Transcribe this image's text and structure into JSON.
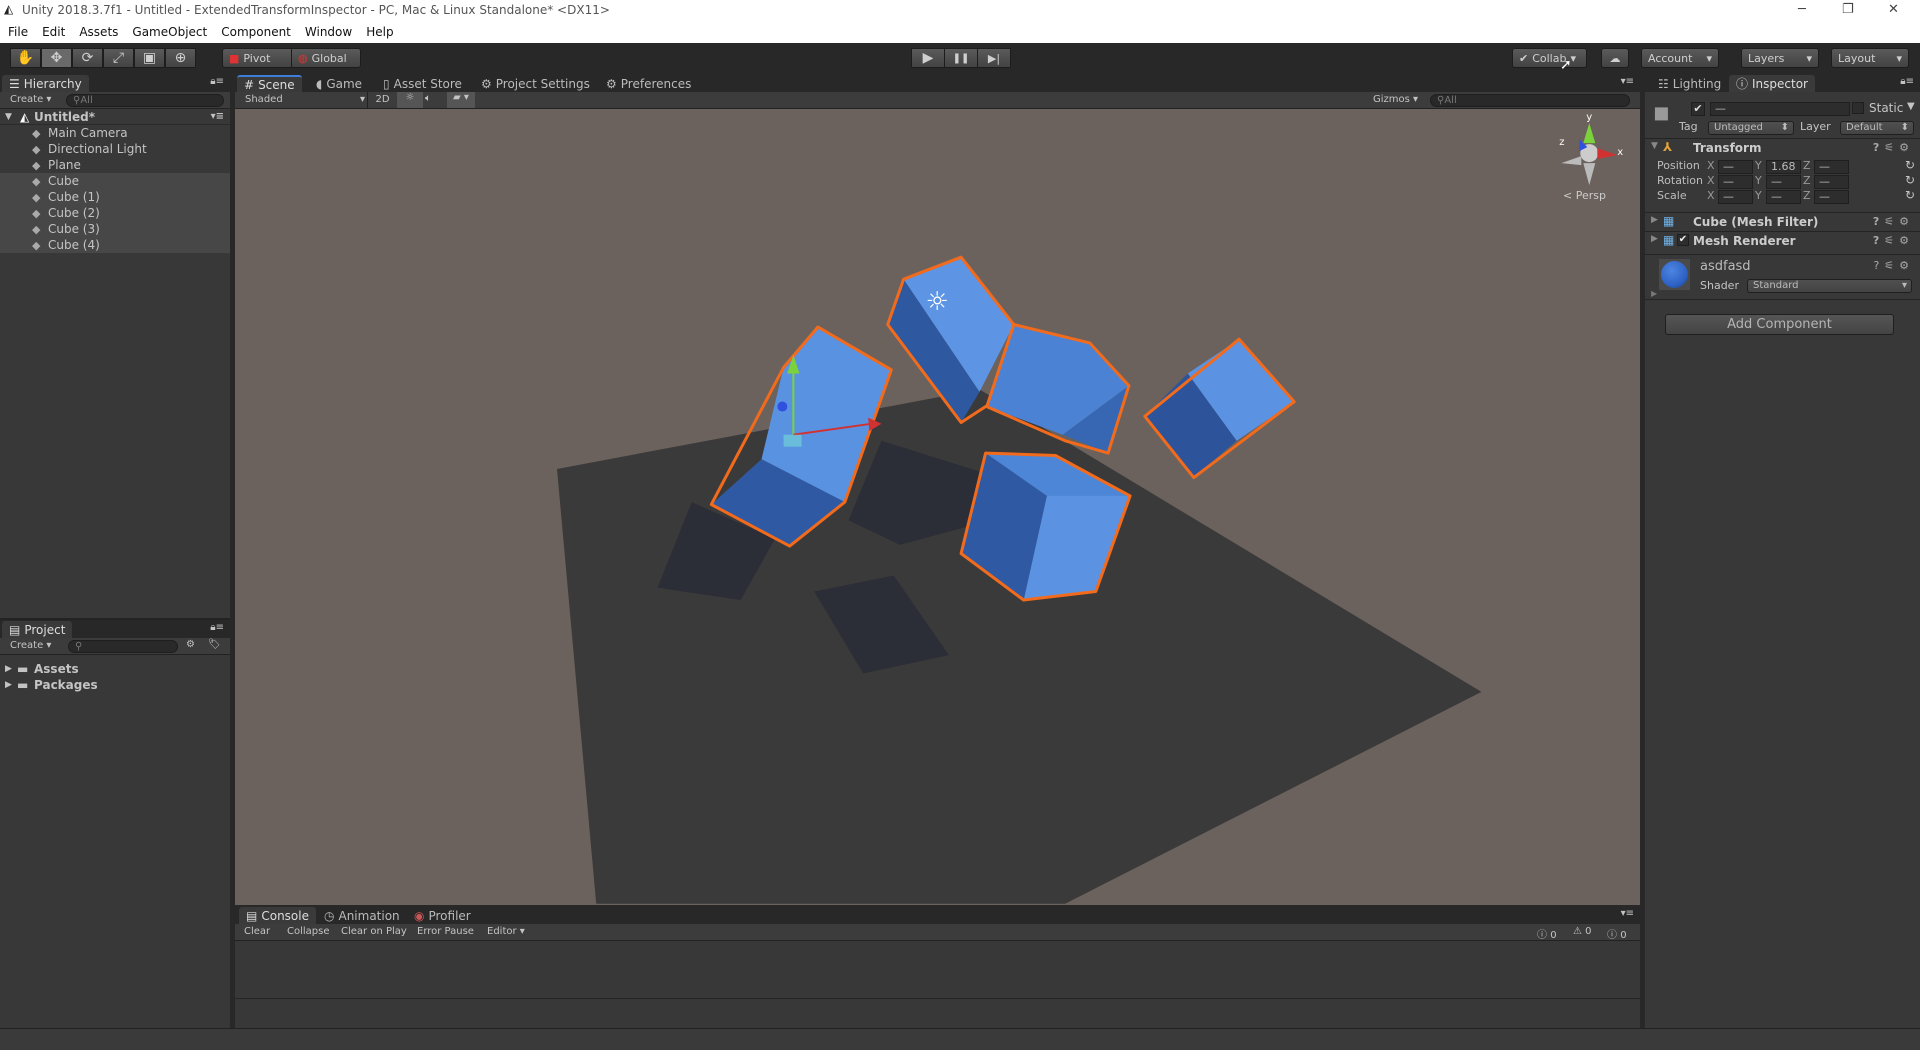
{
  "window": {
    "title": "Unity 2018.3.7f1 - Untitled - ExtendedTransformInspector - PC, Mac & Linux Standalone* <DX11>",
    "minimize": "─",
    "restore": "❐",
    "close": "✕"
  },
  "menu": [
    "File",
    "Edit",
    "Assets",
    "GameObject",
    "Component",
    "Window",
    "Help"
  ],
  "toolbar": {
    "tools": [
      "hand-tool",
      "move-tool",
      "rotate-tool",
      "scale-tool",
      "rect-tool",
      "transform-tool"
    ],
    "tool_glyphs": [
      "✋",
      "✥",
      "⟳",
      "⤢",
      "▣",
      "⊕"
    ],
    "active_tool": 1,
    "pivot": "Pivot",
    "global": "Global",
    "play": "▶",
    "pause": "❚❚",
    "step": "▶|",
    "collab": "Collab",
    "account": "Account",
    "layers": "Layers",
    "layout": "Layout"
  },
  "hierarchy": {
    "tab": "Hierarchy",
    "create": "Create",
    "search_placeholder": "All",
    "scene": "Untitled*",
    "items": [
      "Main Camera",
      "Directional Light",
      "Plane",
      "Cube",
      "Cube (1)",
      "Cube (2)",
      "Cube (3)",
      "Cube (4)"
    ],
    "selected": [
      3,
      4,
      5,
      6,
      7
    ]
  },
  "project": {
    "tab": "Project",
    "create": "Create",
    "folders": [
      "Assets",
      "Packages"
    ]
  },
  "scene_tabs": [
    "Scene",
    "Game",
    "Asset Store",
    "Project Settings",
    "Preferences"
  ],
  "scene_bar": {
    "shading": "Shaded",
    "mode2d": "2D",
    "gizmos": "Gizmos",
    "search_placeholder": "All",
    "persp": "Persp",
    "axis_y": "y",
    "axis_z": "z",
    "axis_x": "x"
  },
  "console": {
    "tabs": [
      "Console",
      "Animation",
      "Profiler"
    ],
    "buttons": [
      "Clear",
      "Collapse",
      "Clear on Play",
      "Error Pause",
      "Editor"
    ],
    "counts": [
      "0",
      "0",
      "0"
    ]
  },
  "inspector": {
    "tabs": [
      "Lighting",
      "Inspector"
    ],
    "name_value": "—",
    "static": "Static",
    "tag_label": "Tag",
    "tag": "Untagged",
    "layer_label": "Layer",
    "layer": "Default",
    "transform": {
      "title": "Transform",
      "rows": [
        {
          "label": "Position",
          "x": "—",
          "y": "1.68",
          "z": "—"
        },
        {
          "label": "Rotation",
          "x": "—",
          "y": "—",
          "z": "—"
        },
        {
          "label": "Scale",
          "x": "—",
          "y": "—",
          "z": "—"
        }
      ]
    },
    "components": [
      "Cube (Mesh Filter)",
      "Mesh Renderer"
    ],
    "material": {
      "name": "asdfasd",
      "shader_label": "Shader",
      "shader": "Standard",
      "color": "#2f63c6"
    },
    "add_component": "Add Component"
  },
  "colors": {
    "selection_outline": "#f26b1d",
    "cube": "#5b93e0",
    "scene_bg": "#6b625d",
    "accent_tab": "#3e7ed8"
  }
}
